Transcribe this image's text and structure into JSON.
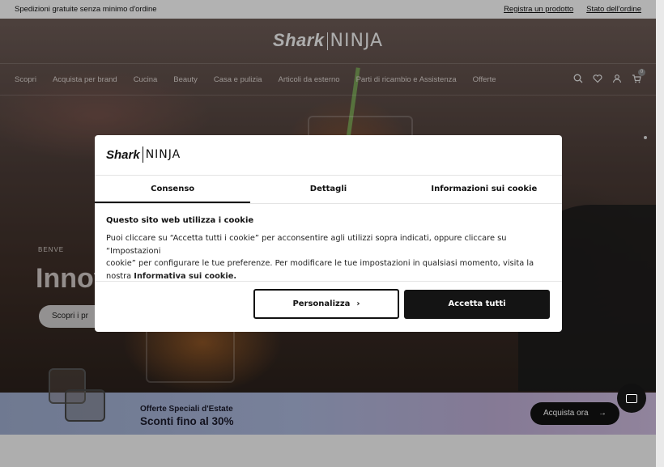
{
  "promo_bar": {
    "message": "Spedizioni gratuite senza minimo d'ordine",
    "links": [
      "Registra un prodotto",
      "Stato dell'ordine"
    ]
  },
  "header": {
    "logo_left": "Shark",
    "logo_right": "NINJA",
    "nav_items": [
      "Scopri",
      "Acquista per brand",
      "Cucina",
      "Beauty",
      "Casa e pulizia",
      "Articoli da esterno",
      "Parti di ricambio e Assistenza",
      "Offerte"
    ],
    "icons": [
      "search-icon",
      "heart-icon",
      "user-icon",
      "cart-icon"
    ],
    "cart_count": "0"
  },
  "hero": {
    "welcome": "BENVE",
    "title": "Innov",
    "cta": "Scopri i pr"
  },
  "summer": {
    "kicker": "Offerte Speciali d'Estate",
    "headline": "Sconti fino al 30%",
    "button": "Acquista ora",
    "button_icon": "arrow-right-icon"
  },
  "cookie_dialog": {
    "logo_left": "Shark",
    "logo_right": "NINJA",
    "tabs": [
      "Consenso",
      "Dettagli",
      "Informazioni sui cookie"
    ],
    "active_tab": "Consenso",
    "heading": "Questo sito web utilizza i cookie",
    "body_line1": "Puoi cliccare su “Accetta tutti i cookie” per acconsentire agli utilizzi sopra indicati, oppure cliccare su “Impostazioni",
    "body_line2": "cookie” per configurare le tue preferenze. Per modificare le tue impostazioni in qualsiasi momento, visita la",
    "body_line3_prefix": "nostra ",
    "body_link": "Informativa sui cookie.",
    "btn_customize": "Personalizza",
    "btn_accept": "Accetta tutti"
  },
  "colors": {
    "dialog_bg": "#ffffff",
    "accept_bg": "#141414",
    "overlay": "rgba(0,0,0,0.28)"
  }
}
